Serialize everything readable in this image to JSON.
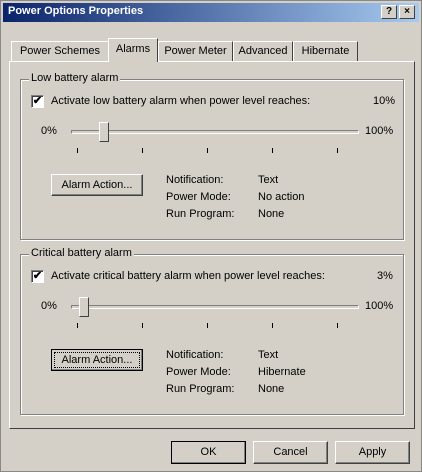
{
  "window": {
    "title": "Power Options Properties",
    "help_label": "?",
    "close_label": "×"
  },
  "tabs": [
    {
      "label": "Power Schemes",
      "active": false
    },
    {
      "label": "Alarms",
      "active": true
    },
    {
      "label": "Power Meter",
      "active": false
    },
    {
      "label": "Advanced",
      "active": false
    },
    {
      "label": "Hibernate",
      "active": false
    }
  ],
  "low_alarm": {
    "legend": "Low battery alarm",
    "checkbox_label": "Activate low battery alarm when power level reaches:",
    "checked": true,
    "level_text": "10%",
    "level_value": 10,
    "min_label": "0%",
    "max_label": "100%",
    "action_button": "Alarm Action...",
    "info": [
      {
        "key": "Notification:",
        "value": "Text"
      },
      {
        "key": "Power Mode:",
        "value": "No action"
      },
      {
        "key": "Run Program:",
        "value": "None"
      }
    ]
  },
  "critical_alarm": {
    "legend": "Critical battery alarm",
    "checkbox_label": "Activate critical battery alarm when power level reaches:",
    "checked": true,
    "level_text": "3%",
    "level_value": 3,
    "min_label": "0%",
    "max_label": "100%",
    "action_button": "Alarm Action...",
    "info": [
      {
        "key": "Notification:",
        "value": "Text"
      },
      {
        "key": "Power Mode:",
        "value": "Hibernate"
      },
      {
        "key": "Run Program:",
        "value": "None"
      }
    ]
  },
  "footer": {
    "ok_label": "OK",
    "cancel_label": "Cancel",
    "apply_label": "Apply"
  }
}
